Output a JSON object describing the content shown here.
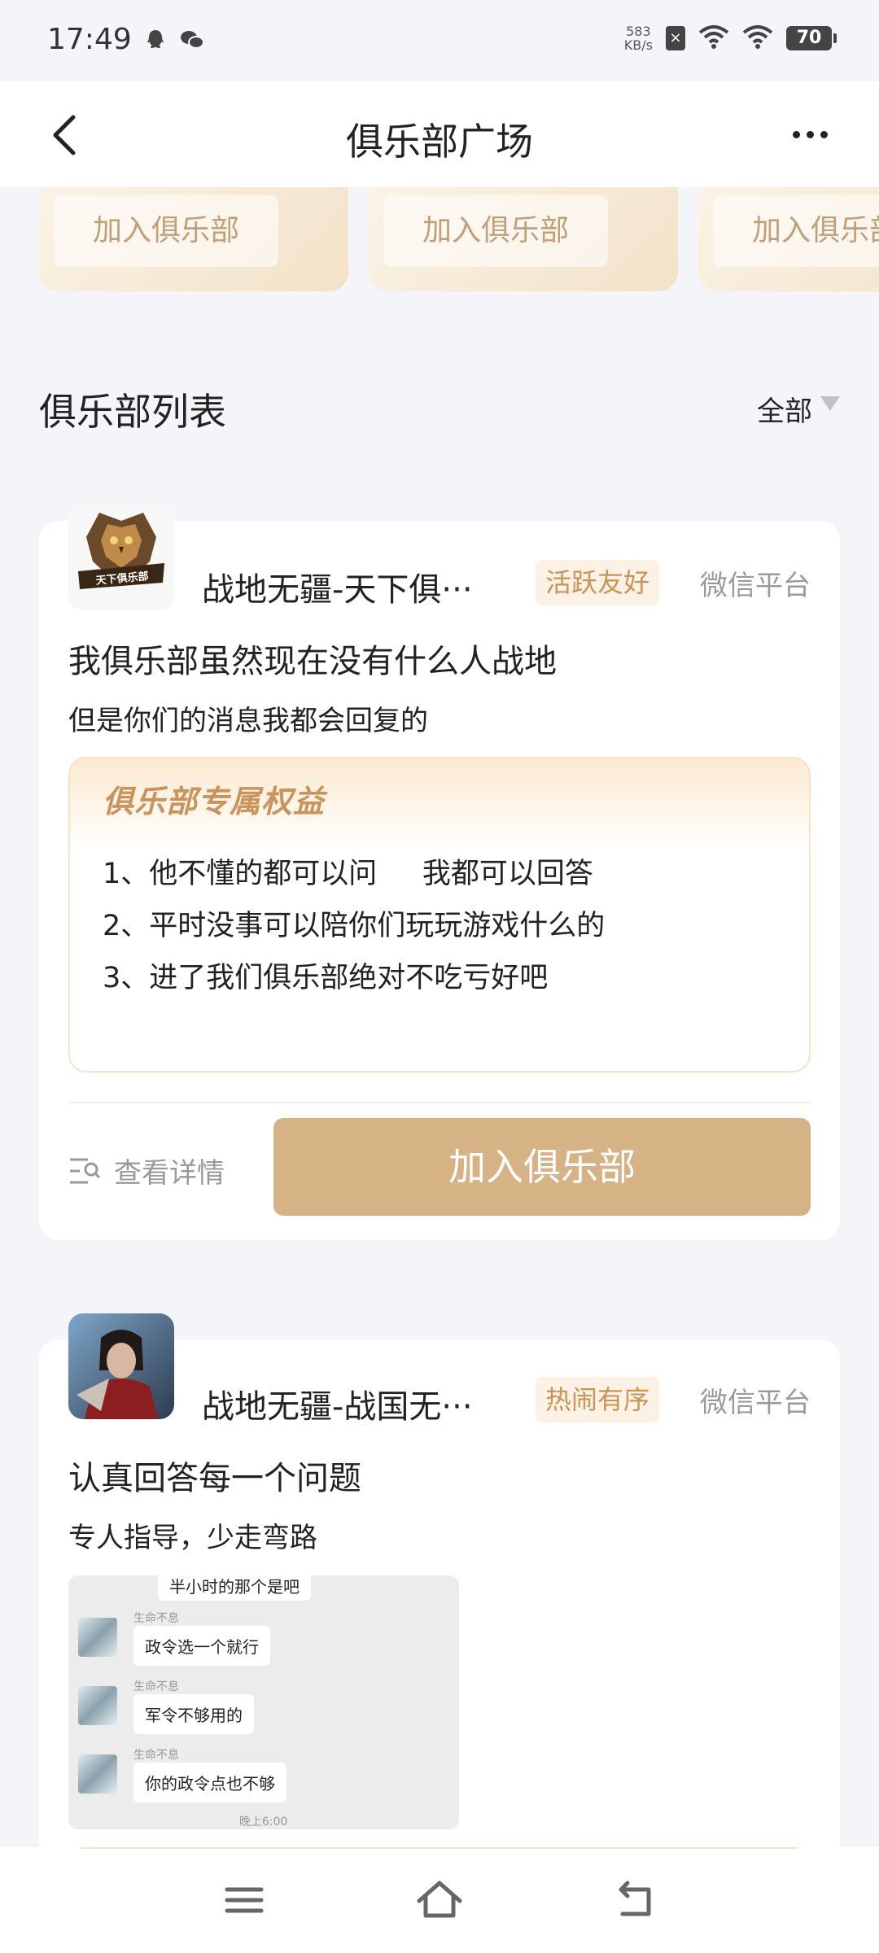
{
  "status_bar": {
    "time": "17:49",
    "net_speed_value": "583",
    "net_speed_unit": "KB/s",
    "battery": "70",
    "icons": [
      "qq-icon",
      "wechat-icon",
      "sim-icon",
      "wifi-signal-icon",
      "wifi-icon",
      "battery-icon"
    ]
  },
  "nav": {
    "title": "俱乐部广场",
    "back_icon": "chevron-left-icon",
    "more_icon": "more-dots-icon"
  },
  "top_cards": [
    {
      "button_label": "加入俱乐部"
    },
    {
      "button_label": "加入俱乐部"
    },
    {
      "button_label": "加入俱乐部"
    }
  ],
  "section": {
    "title": "俱乐部列表",
    "filter_label": "全部"
  },
  "clubs": [
    {
      "logo_text": "天下俱乐部",
      "name": "战地无疆-天下俱···",
      "tag": "活跃友好",
      "platform": "微信平台",
      "title": "我俱乐部虽然现在没有什么人战地",
      "subtitle": "但是你们的消息我都会回复的",
      "benefit_title": "俱乐部专属权益",
      "benefits": [
        "1、他不懂的都可以问     我都可以回答",
        "2、平时没事可以陪你们玩玩游戏什么的",
        "3、进了我们俱乐部绝对不吃亏好吧"
      ],
      "detail_label": "查看详情",
      "join_label": "加入俱乐部"
    },
    {
      "name": "战地无疆-战国无···",
      "tag": "热闹有序",
      "platform": "微信平台",
      "title": "认真回答每一个问题",
      "subtitle": "专人指导，少走弯路",
      "chat": {
        "top_fragment": "半小时的那个是吧",
        "messages": [
          {
            "sender": "生命不息",
            "text": "政令选一个就行"
          },
          {
            "sender": "生命不息",
            "text": "军令不够用的"
          },
          {
            "sender": "生命不息",
            "text": "你的政令点也不够"
          }
        ],
        "time": "晚上6:00"
      }
    }
  ],
  "bottom_nav": {
    "icons": [
      "menu-icon",
      "home-icon",
      "back-arrow-icon"
    ]
  },
  "colors": {
    "accent": "#d6b385",
    "tag_text": "#c99455",
    "tag_bg": "#fbf1e4",
    "page_bg": "#f4f5f9"
  }
}
